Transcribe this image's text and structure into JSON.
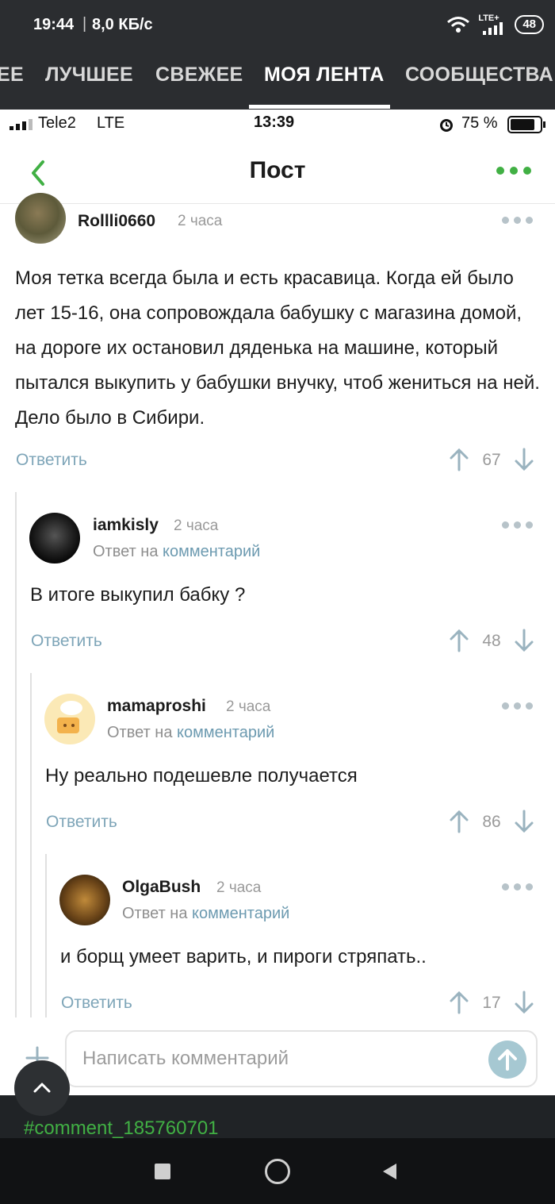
{
  "status_bar": {
    "time": "19:44",
    "speed": "8,0 КБ/с",
    "lte": "LTE+",
    "battery": "48"
  },
  "tabs": [
    {
      "label": "ЕЕ"
    },
    {
      "label": "ЛУЧШЕЕ"
    },
    {
      "label": "СВЕЖЕЕ"
    },
    {
      "label": "МОЯ ЛЕНТА"
    },
    {
      "label": "СООБЩЕСТВА"
    }
  ],
  "ios_bar": {
    "carrier": "Tele2",
    "network": "LTE",
    "time": "13:39",
    "battery": "75 %"
  },
  "header": {
    "title": "Пост"
  },
  "comments": [
    {
      "author": "Rollli0660",
      "time": "2 часа",
      "text": "Моя тетка всегда была и есть красавица. Когда ей было лет 15-16, она сопровождала бабушку с магазина домой, на дороге их остановил дяденька на машине, который пытался выкупить у бабушки внучку, чтоб жениться на ней. Дело было в Сибири.",
      "reply_label": "Ответить",
      "score": "67"
    },
    {
      "author": "iamkisly",
      "time": "2 часа",
      "reply_prefix": "Ответ на",
      "reply_target": "комментарий",
      "text": "В итоге выкупил бабку ?",
      "reply_label": "Ответить",
      "score": "48"
    },
    {
      "author": "mamaproshi",
      "time": "2 часа",
      "reply_prefix": "Ответ на",
      "reply_target": "комментарий",
      "text": "Ну реально подешевле получается",
      "reply_label": "Ответить",
      "score": "86"
    },
    {
      "author": "OlgaBush",
      "time": "2 часа",
      "reply_prefix": "Ответ на",
      "reply_target": "комментарий",
      "text": "и борщ умеет варить, и пироги стряпать..",
      "reply_label": "Ответить",
      "score": "17"
    }
  ],
  "compose": {
    "placeholder": "Написать комментарий"
  },
  "link": "#comment_185760701",
  "colors": {
    "accent_green": "#41b044",
    "dark_bar": "#2b2d30",
    "reply_blue": "#7ea5b8"
  }
}
